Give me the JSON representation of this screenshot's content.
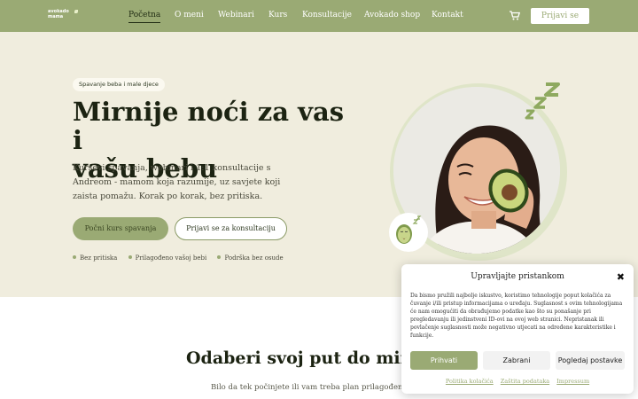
{
  "nav": {
    "logo_text": "avokado mama",
    "items": [
      "Početna",
      "O meni",
      "Webinari",
      "Kurs",
      "Konsultacije",
      "Avokado shop",
      "Kontakt"
    ],
    "login_label": "Prijavi se"
  },
  "hero": {
    "pill": "Spavanje beba i male djece",
    "title_line1": "Mirnije noći za vas i",
    "title_line2": "vašu bebu",
    "lead": "Kursevi spavanja, webinari i 1:1 konsultacije s Andreom - mamom koja razumije, uz savjete koji zaista pomažu. Korak po korak, bez pritiska.",
    "primary_button": "Počni kurs spavanja",
    "secondary_button": "Prijavi se za konsultaciju",
    "bullets": [
      "Bez pritiska",
      "Prilagođeno vašoj bebi",
      "Podrška bez osude"
    ]
  },
  "section": {
    "title": "Odaberi svoj put do mirniji",
    "subtitle": "Bilo da tek počinjete ili vam treba plan prilagođen baš vam"
  },
  "cookie": {
    "title": "Upravljajte pristankom",
    "text": "Da bismo pružili najbolje iskustvo, koristimo tehnologije poput kolačića za čuvanje i/ili pristup informacijama o uređaju. Suglasnost s ovim tehnologijama će nam omogućiti da obrađujemo podatke kao što su ponašanje pri pregledavanju ili jedinstveni ID-ovi na ovoj web stranici. Nepristanak ili povlačenje suglasnosti može negativno utjecati na određene karakteristike i funkcije.",
    "accept": "Prihvati",
    "deny": "Zabrani",
    "prefs": "Pogledaj postavke",
    "links": [
      "Politika kolačića",
      "Zaštita podataka",
      "Impressum"
    ]
  },
  "colors": {
    "accent": "#9aaa74",
    "hero_bg": "#f0edde",
    "dark": "#1c2312"
  },
  "icons": {
    "cart": "cart-icon",
    "close": "close-icon",
    "sleep": "zzz-icon"
  }
}
